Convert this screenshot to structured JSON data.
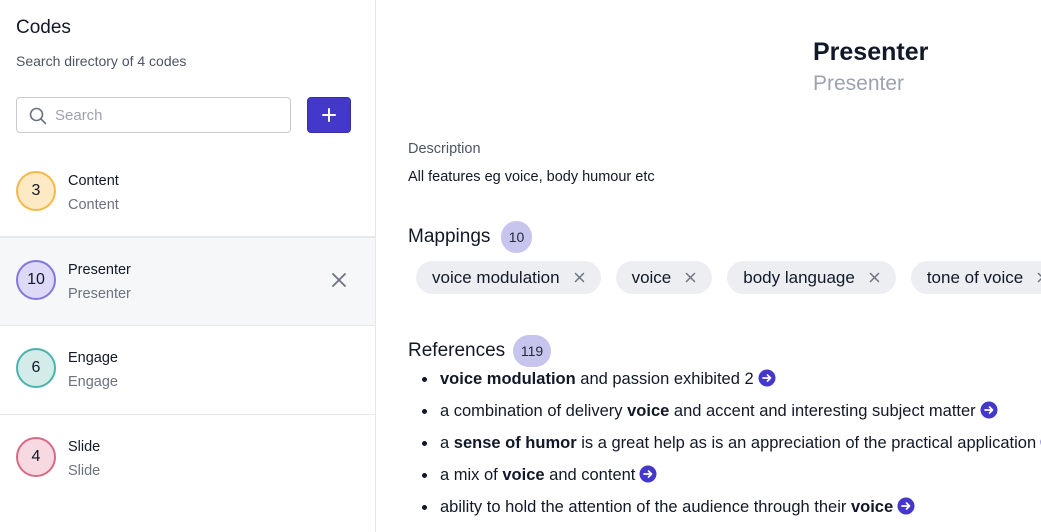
{
  "sidebar": {
    "title": "Codes",
    "subtitle": "Search directory of 4 codes",
    "search_placeholder": "Search",
    "add_icon": "plus-icon"
  },
  "codes": [
    {
      "count": "3",
      "name": "Content",
      "sub": "Content",
      "color": "#f5b94a",
      "fill": "#fde9c4",
      "selected": false
    },
    {
      "count": "10",
      "name": "Presenter",
      "sub": "Presenter",
      "color": "#8178e0",
      "fill": "#ddd9f7",
      "selected": true
    },
    {
      "count": "6",
      "name": "Engage",
      "sub": "Engage",
      "color": "#4bb3ad",
      "fill": "#d3ecea",
      "selected": false
    },
    {
      "count": "4",
      "name": "Slide",
      "sub": "Slide",
      "color": "#d76a86",
      "fill": "#f6d9e1",
      "selected": false
    }
  ],
  "detail": {
    "title": "Presenter",
    "subtitle": "Presenter",
    "description_label": "Description",
    "description": "All features eg voice, body humour etc",
    "mappings_label": "Mappings",
    "mappings_count": "10",
    "mappings": [
      "voice modulation",
      "voice",
      "body language",
      "tone of voice"
    ],
    "references_label": "References",
    "references_count": "119",
    "references": [
      [
        {
          "t": "voice modulation",
          "b": true
        },
        {
          "t": " and passion exhibited 2",
          "b": false
        }
      ],
      [
        {
          "t": "a combination of delivery ",
          "b": false
        },
        {
          "t": "voice",
          "b": true
        },
        {
          "t": " and accent and interesting subject matter",
          "b": false
        }
      ],
      [
        {
          "t": "a ",
          "b": false
        },
        {
          "t": "sense of humor",
          "b": true
        },
        {
          "t": " is a great help as is an appreciation of the practical application",
          "b": false
        }
      ],
      [
        {
          "t": "a mix of ",
          "b": false
        },
        {
          "t": "voice",
          "b": true
        },
        {
          "t": " and content",
          "b": false
        }
      ],
      [
        {
          "t": "ability to hold the attention of the audience through their ",
          "b": false
        },
        {
          "t": "voice",
          "b": true
        }
      ]
    ]
  },
  "colors": {
    "accent": "#4338ca",
    "count_pill": "#c7c5ee"
  }
}
